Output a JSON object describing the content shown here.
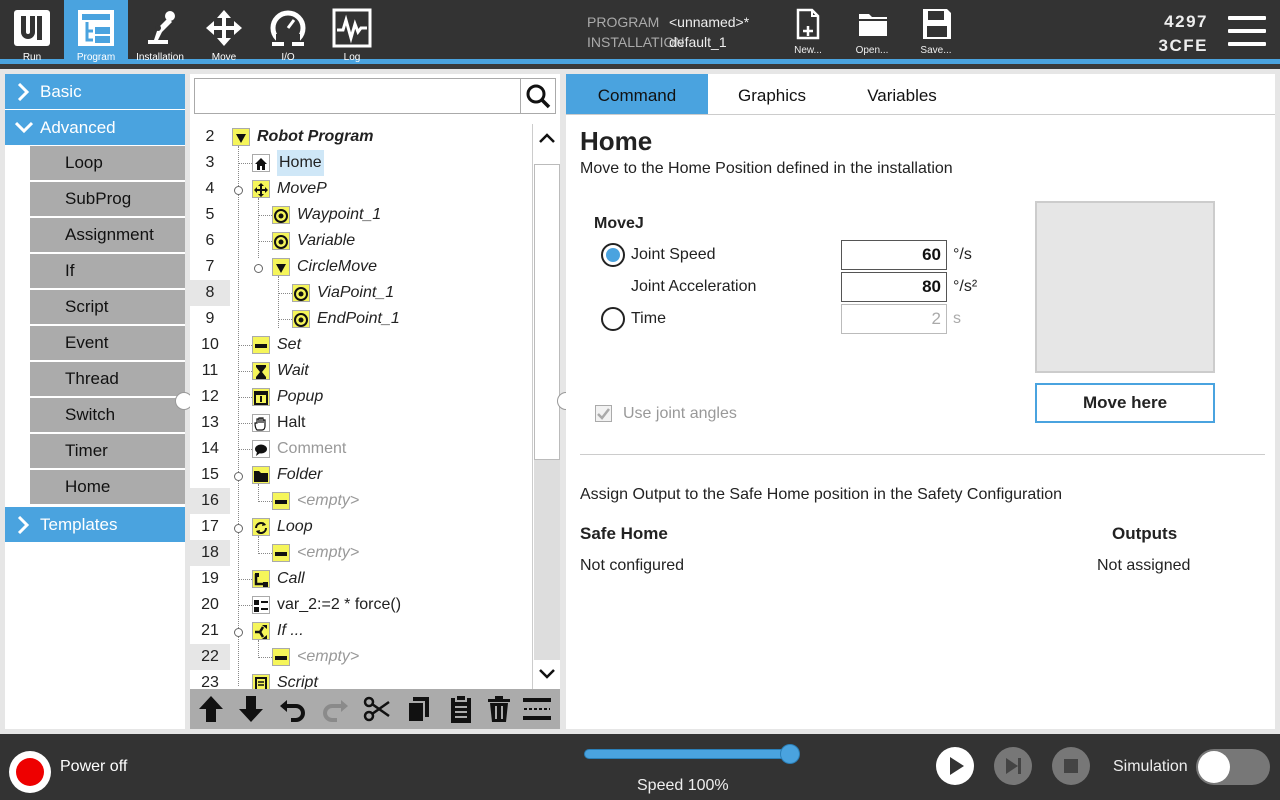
{
  "topbar": {
    "nav": [
      {
        "label": "Run"
      },
      {
        "label": "Program"
      },
      {
        "label": "Installation"
      },
      {
        "label": "Move"
      },
      {
        "label": "I/O"
      },
      {
        "label": "Log"
      }
    ],
    "program_key": "PROGRAM",
    "program_value": "<unnamed>*",
    "installation_key": "INSTALLATION",
    "installation_value": "default_1",
    "file_buttons": [
      {
        "label": "New..."
      },
      {
        "label": "Open..."
      },
      {
        "label": "Save..."
      }
    ],
    "serial_line1": "4297",
    "serial_line2": "3CFE"
  },
  "left_panel": {
    "basic_label": "Basic",
    "advanced_label": "Advanced",
    "advanced_items": [
      "Loop",
      "SubProg",
      "Assignment",
      "If",
      "Script",
      "Event",
      "Thread",
      "Switch",
      "Timer",
      "Home"
    ],
    "templates_label": "Templates"
  },
  "tree": {
    "search_placeholder": "",
    "line_numbers": [
      "2",
      "3",
      "4",
      "5",
      "6",
      "7",
      "8",
      "9",
      "10",
      "11",
      "12",
      "13",
      "14",
      "15",
      "16",
      "17",
      "18",
      "19",
      "20",
      "21",
      "22",
      "23"
    ],
    "nodes": [
      {
        "text": "Robot Program",
        "icon": "triangle-down-icon"
      },
      {
        "text": "Home",
        "icon": "home-icon"
      },
      {
        "text": "MoveP",
        "icon": "move-icon"
      },
      {
        "text": "Waypoint_1",
        "icon": "waypoint-icon"
      },
      {
        "text": "Variable",
        "icon": "waypoint-icon"
      },
      {
        "text": "CircleMove",
        "icon": "triangle-down-icon"
      },
      {
        "text": "ViaPoint_1",
        "icon": "waypoint-icon"
      },
      {
        "text": "EndPoint_1",
        "icon": "waypoint-icon"
      },
      {
        "text": "Set",
        "icon": "set-icon"
      },
      {
        "text": "Wait",
        "icon": "hourglass-icon"
      },
      {
        "text": "Popup",
        "icon": "popup-icon"
      },
      {
        "text": "Halt",
        "icon": "hand-icon"
      },
      {
        "text": "Comment",
        "icon": "comment-icon"
      },
      {
        "text": "Folder",
        "icon": "folder-icon"
      },
      {
        "text": "<empty>",
        "icon": "empty-icon"
      },
      {
        "text": "Loop",
        "icon": "loop-icon"
      },
      {
        "text": "<empty>",
        "icon": "empty-icon"
      },
      {
        "text": "Call",
        "icon": "call-icon"
      },
      {
        "text": "var_2:=2 * force()",
        "icon": "assignment-icon"
      },
      {
        "text": "If ...",
        "icon": "if-icon"
      },
      {
        "text": "<empty>",
        "icon": "empty-icon"
      },
      {
        "text": "Script",
        "icon": "script-icon"
      }
    ]
  },
  "right_panel": {
    "tabs": [
      "Command",
      "Graphics",
      "Variables"
    ],
    "title": "Home",
    "subtitle": "Move to the Home Position defined in the installation",
    "movej_label": "MoveJ",
    "joint_speed_label": "Joint Speed",
    "joint_speed_value": "60",
    "joint_speed_unit": "°/s",
    "joint_accel_label": "Joint Acceleration",
    "joint_accel_value": "80",
    "joint_accel_unit": "°/s²",
    "time_label": "Time",
    "time_value": "2",
    "time_unit": "s",
    "use_joint_angles_label": "Use joint angles",
    "move_here_label": "Move here",
    "assign_output_text": "Assign Output to the Safe Home position in the Safety Configuration",
    "safe_home_header": "Safe Home",
    "outputs_header": "Outputs",
    "safe_home_value": "Not configured",
    "outputs_value": "Not assigned"
  },
  "bottombar": {
    "power_label": "Power off",
    "speed_label": "Speed 100%",
    "speed_value": 100,
    "simulation_label": "Simulation"
  },
  "colors": {
    "accent": "#4aa3df",
    "topbar": "#333333",
    "node_icon_yellow": "#f5f55a"
  }
}
